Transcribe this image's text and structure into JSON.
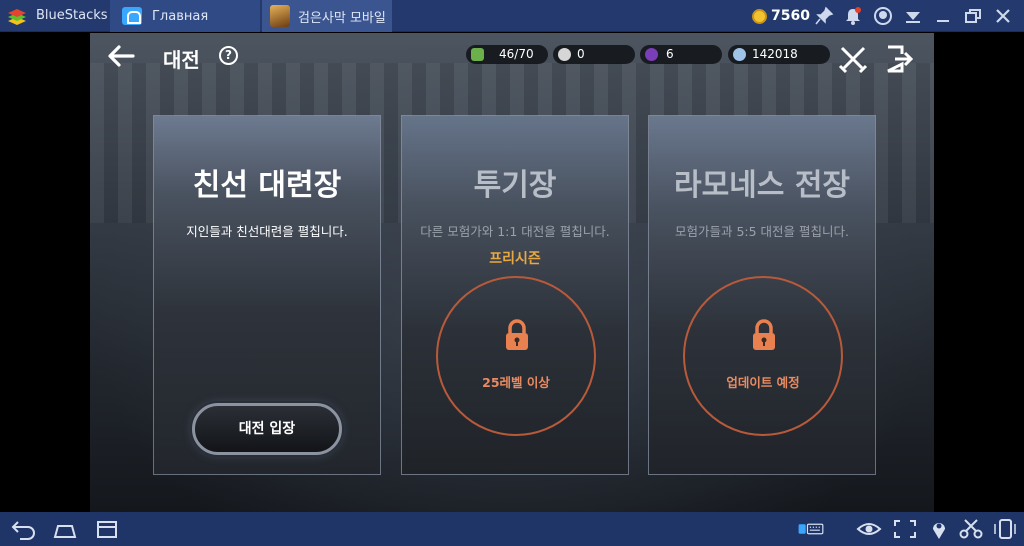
{
  "titlebar": {
    "app_name": "BlueStacks",
    "home_tab_label": "Главная",
    "game_tab_label": "검은사막 모바일",
    "coins": "7560",
    "icons": [
      "pin-icon",
      "bell-icon",
      "account-icon",
      "menu-icon",
      "minimize-icon",
      "restore-icon",
      "close-icon"
    ]
  },
  "header": {
    "title": "대전",
    "help": "?"
  },
  "resources": {
    "energy": "46/70",
    "pearls": "0",
    "crystals": "6",
    "silver": "142018"
  },
  "cards": [
    {
      "title": "친선 대련장",
      "description": "지인들과 친선대련을 펼칩니다.",
      "button_label": "대전 입장"
    },
    {
      "title": "투기장",
      "description": "다른 모험가와 1:1 대전을 펼칩니다.",
      "tag": "프리시즌",
      "lock_label": "25레벨 이상"
    },
    {
      "title": "라모네스 전장",
      "description": "모험가들과 5:5 대전을 펼칩니다.",
      "lock_label": "업데이트 예정"
    }
  ],
  "colors": {
    "titlebar_bg": "#243a6e",
    "accent_orange": "#e8a842",
    "lock_red": "#b85a3a"
  }
}
